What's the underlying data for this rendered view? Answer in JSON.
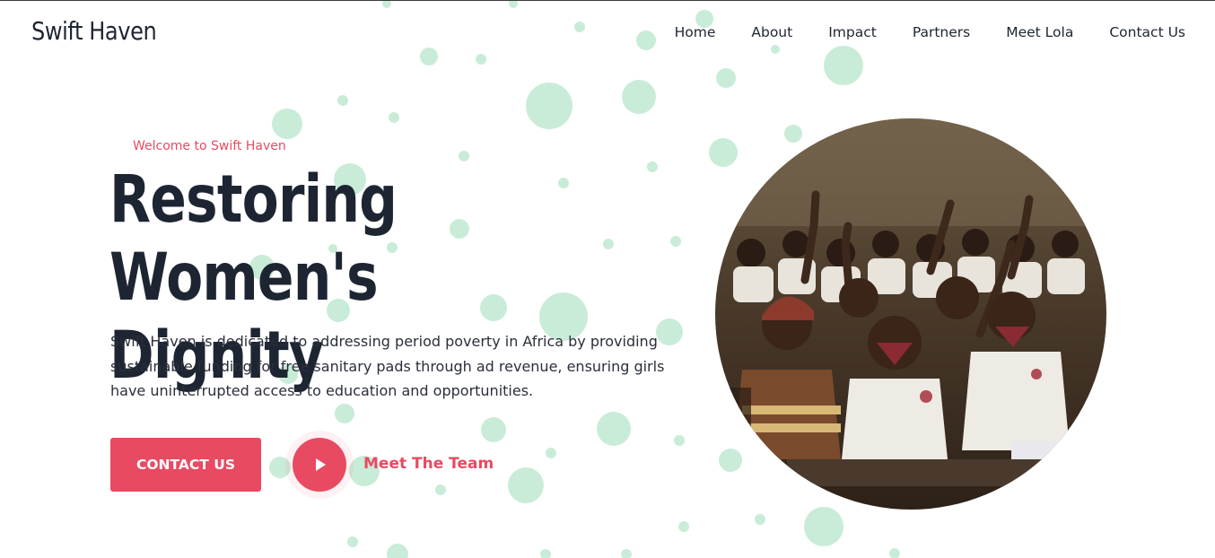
{
  "header": {
    "brand": "Swift Haven",
    "nav": [
      "Home",
      "About",
      "Impact",
      "Partners",
      "Meet Lola",
      "Contact Us"
    ]
  },
  "hero": {
    "eyebrow": "Welcome to Swift Haven",
    "title_line1": "Restoring Women's",
    "title_line2": "Dignity",
    "description": "Swift Haven is dedicated to addressing period poverty in Africa by providing sustainable funding for free sanitary pads through ad revenue, ensuring girls have uninterrupted access to education and opportunities.",
    "cta_label": "CONTACT US",
    "team_label": "Meet The Team"
  },
  "theme": {
    "accent": "#e84a62",
    "dot_color": "#c9ecd8",
    "text_dark": "#1e2532"
  },
  "icons": {
    "play": "play-icon"
  }
}
